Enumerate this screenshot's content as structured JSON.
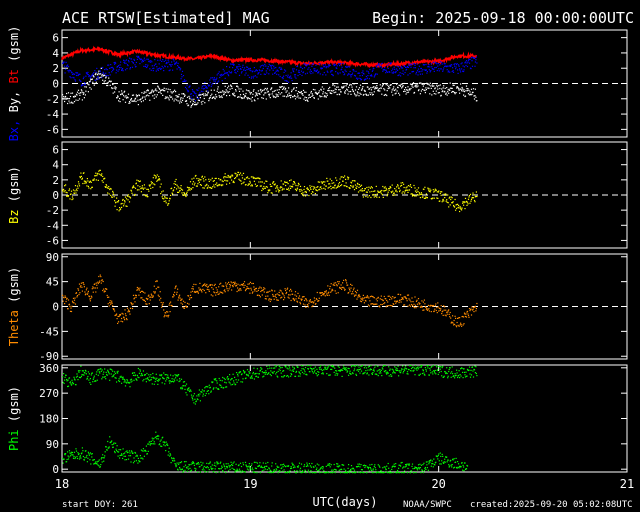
{
  "header": {
    "title": "ACE RTSW[Estimated] MAG",
    "begin": "Begin: 2025-09-18 00:00:00UTC"
  },
  "footer": {
    "start_doy": "start DOY:  261",
    "xlabel": "UTC(days)",
    "source": "NOAA/SWPC",
    "created": "created:2025-09-20 05:02:08UTC"
  },
  "colors": {
    "background": "#000000",
    "axes": "#ffffff",
    "bt": "#ff0000",
    "bx": "#ffffff",
    "by": "#0000ff",
    "bz": "#ffff00",
    "theta": "#ff8c00",
    "phi": "#00ff00"
  },
  "chart_data": {
    "type": "scatter",
    "x_axis": {
      "label": "UTC(days)",
      "range": [
        18,
        21
      ],
      "ticks": [
        18,
        19,
        20,
        21
      ]
    },
    "panels": [
      {
        "id": "bt-bx-by",
        "ylabel_parts": [
          {
            "text": "Bx,",
            "color": "#0000ff"
          },
          {
            "text": " By,",
            "color": "#ffffff"
          },
          {
            "text": " Bt",
            "color": "#ff0000"
          },
          {
            "text": " (gsm)",
            "color": "#ffffff"
          }
        ],
        "ylim": [
          -7,
          7
        ],
        "yticks": [
          -6,
          -4,
          -2,
          0,
          2,
          4,
          6
        ],
        "zero_line": true,
        "series": [
          {
            "name": "Bt",
            "color": "#ff0000",
            "style": "line",
            "x": [
              18.0,
              18.1,
              18.2,
              18.3,
              18.4,
              18.5,
              18.6,
              18.7,
              18.8,
              18.9,
              19.0,
              19.1,
              19.2,
              19.3,
              19.4,
              19.5,
              19.6,
              19.7,
              19.8,
              19.9,
              20.0,
              20.1,
              20.2
            ],
            "y": [
              3.3,
              4.3,
              4.5,
              3.8,
              4.2,
              3.7,
              3.4,
              3.2,
              3.6,
              3.0,
              3.1,
              3.0,
              2.8,
              2.6,
              2.8,
              2.7,
              2.5,
              2.4,
              2.6,
              2.8,
              2.9,
              3.6,
              3.6
            ]
          },
          {
            "name": "By",
            "color": "#0000ff",
            "style": "scatter",
            "x": [
              18.0,
              18.1,
              18.2,
              18.3,
              18.4,
              18.5,
              18.6,
              18.7,
              18.8,
              18.9,
              19.0,
              19.1,
              19.2,
              19.3,
              19.4,
              19.5,
              19.6,
              19.7,
              19.8,
              19.9,
              20.0,
              20.1,
              20.2
            ],
            "y": [
              2.5,
              0.5,
              1.5,
              2.3,
              3.0,
              2.4,
              2.6,
              -1.8,
              0.5,
              2.0,
              1.5,
              2.0,
              1.0,
              2.2,
              1.8,
              2.0,
              1.0,
              2.2,
              1.8,
              2.0,
              2.2,
              2.0,
              3.0
            ]
          },
          {
            "name": "Bx",
            "color": "#ffffff",
            "style": "scatter",
            "x": [
              18.0,
              18.1,
              18.2,
              18.3,
              18.4,
              18.5,
              18.6,
              18.7,
              18.8,
              18.9,
              19.0,
              19.1,
              19.2,
              19.3,
              19.4,
              19.5,
              19.6,
              19.7,
              19.8,
              19.9,
              20.0,
              20.1,
              20.2
            ],
            "y": [
              -2.0,
              -1.5,
              1.5,
              -1.5,
              -2.0,
              -1.0,
              -1.5,
              -2.5,
              -1.2,
              -0.8,
              -1.5,
              -1.2,
              -1.0,
              -1.5,
              -1.0,
              -0.5,
              -1.0,
              -0.8,
              -0.7,
              -0.5,
              -0.8,
              -0.5,
              -1.5
            ]
          }
        ]
      },
      {
        "id": "bz",
        "ylabel_parts": [
          {
            "text": "Bz",
            "color": "#ffff00"
          },
          {
            "text": "  (gsm)",
            "color": "#ffffff"
          }
        ],
        "ylim": [
          -7,
          7
        ],
        "yticks": [
          -6,
          -4,
          -2,
          0,
          2,
          4,
          6
        ],
        "zero_line": true,
        "series": [
          {
            "name": "Bz",
            "color": "#ffff00",
            "style": "scatter",
            "x": [
              18.0,
              18.05,
              18.1,
              18.15,
              18.2,
              18.25,
              18.3,
              18.35,
              18.4,
              18.45,
              18.5,
              18.55,
              18.6,
              18.65,
              18.7,
              18.8,
              18.9,
              19.0,
              19.1,
              19.2,
              19.3,
              19.4,
              19.5,
              19.6,
              19.7,
              19.8,
              19.9,
              20.0,
              20.1,
              20.2
            ],
            "y": [
              1.0,
              0.0,
              2.5,
              1.5,
              3.0,
              0.5,
              -1.5,
              -0.5,
              1.5,
              0.5,
              2.5,
              -1.0,
              1.5,
              0.0,
              2.0,
              1.5,
              2.5,
              2.0,
              1.0,
              1.5,
              0.5,
              1.5,
              2.0,
              0.5,
              0.5,
              1.0,
              0.5,
              0.0,
              -1.5,
              0.0
            ]
          }
        ]
      },
      {
        "id": "theta",
        "ylabel_parts": [
          {
            "text": "Theta",
            "color": "#ff8c00"
          },
          {
            "text": "  (gsm)",
            "color": "#ffffff"
          }
        ],
        "ylim": [
          -95,
          95
        ],
        "yticks": [
          -90,
          -45,
          0,
          45,
          90
        ],
        "zero_line": true,
        "series": [
          {
            "name": "Theta",
            "color": "#ff8c00",
            "style": "scatter",
            "x": [
              18.0,
              18.05,
              18.1,
              18.15,
              18.2,
              18.25,
              18.3,
              18.35,
              18.4,
              18.45,
              18.5,
              18.55,
              18.6,
              18.65,
              18.7,
              18.8,
              18.9,
              19.0,
              19.1,
              19.2,
              19.3,
              19.4,
              19.5,
              19.6,
              19.7,
              19.8,
              19.9,
              20.0,
              20.1,
              20.2
            ],
            "y": [
              15,
              0,
              40,
              20,
              50,
              10,
              -25,
              -10,
              30,
              10,
              40,
              -20,
              30,
              0,
              35,
              30,
              40,
              35,
              20,
              25,
              5,
              30,
              40,
              10,
              10,
              15,
              5,
              0,
              -30,
              0
            ]
          }
        ]
      },
      {
        "id": "phi",
        "ylabel_parts": [
          {
            "text": "Phi",
            "color": "#00ff00"
          },
          {
            "text": "  (gsm)",
            "color": "#ffffff"
          }
        ],
        "ylim": [
          -10,
          370
        ],
        "yticks": [
          0,
          90,
          180,
          270,
          360
        ],
        "zero_line": false,
        "series": [
          {
            "name": "Phi upper",
            "color": "#00ff00",
            "style": "scatter",
            "x": [
              18.0,
              18.05,
              18.1,
              18.15,
              18.2,
              18.3,
              18.35,
              18.4,
              18.5,
              18.6,
              18.7,
              18.8,
              18.9,
              19.0,
              19.1,
              19.2,
              19.3,
              19.4,
              19.5,
              19.6,
              19.7,
              19.8,
              19.9,
              20.0,
              20.1,
              20.2
            ],
            "y": [
              330,
              300,
              350,
              320,
              345,
              330,
              310,
              340,
              320,
              330,
              250,
              300,
              320,
              340,
              350,
              350,
              355,
              355,
              350,
              360,
              350,
              355,
              355,
              350,
              345,
              350
            ]
          },
          {
            "name": "Phi lower",
            "color": "#00ff00",
            "style": "scatter",
            "x": [
              18.0,
              18.1,
              18.2,
              18.25,
              18.3,
              18.4,
              18.45,
              18.5,
              18.55,
              18.6,
              19.7,
              19.8,
              19.9,
              20.0,
              20.1,
              20.15
            ],
            "y": [
              40,
              60,
              20,
              100,
              60,
              40,
              70,
              120,
              80,
              10,
              0,
              5,
              0,
              40,
              20,
              10
            ]
          }
        ]
      }
    ]
  }
}
